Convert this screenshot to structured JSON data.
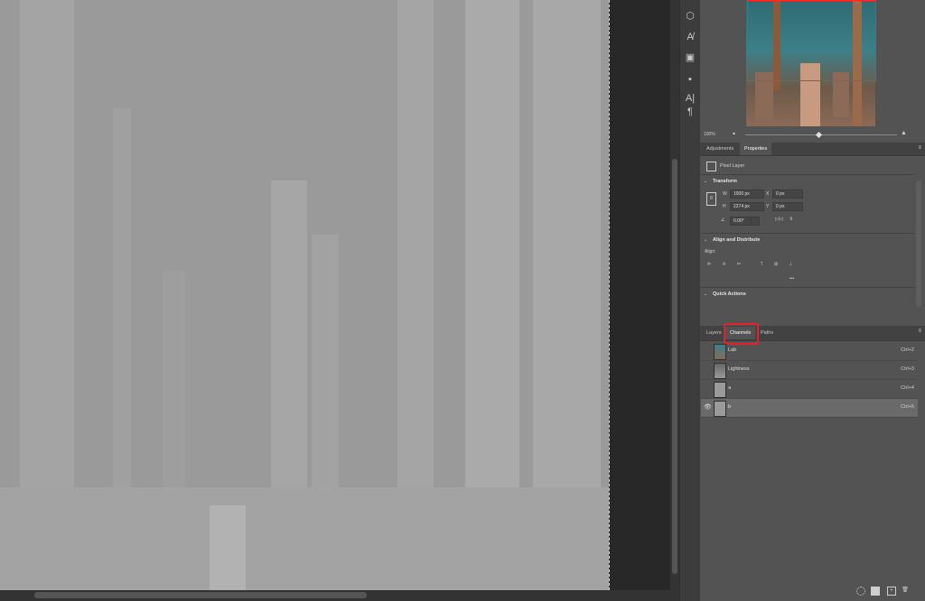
{
  "navigator": {
    "zoom_label": "100%"
  },
  "tool_strip": {
    "icons": [
      "3d-icon",
      "character-style-icon",
      "swatches-icon",
      "libraries-icon",
      "character-icon",
      "paragraph-icon"
    ],
    "glyphs": [
      "⬡",
      "A̸",
      "▣",
      "▪",
      "A|",
      "¶"
    ]
  },
  "properties_panel": {
    "tabs": [
      "Adjustments",
      "Properties"
    ],
    "layer_kind": "Pixel Layer",
    "transform": {
      "title": "Transform",
      "w_label": "W",
      "w_value": "1500 px",
      "h_label": "H",
      "h_value": "2274 px",
      "x_label": "X",
      "x_value": "0 px",
      "y_label": "Y",
      "y_value": "0 px",
      "angle_value": "0.00°"
    },
    "align": {
      "title": "Align and Distribute",
      "align_label": "Align:",
      "more": "•••"
    },
    "quick_actions": {
      "title": "Quick Actions"
    }
  },
  "channels_panel": {
    "tabs": [
      "Layers",
      "Channels",
      "Paths"
    ],
    "rows": [
      {
        "name": "Lab",
        "shortcut": "Ctrl+2"
      },
      {
        "name": "Lightness",
        "shortcut": "Ctrl+3"
      },
      {
        "name": "a",
        "shortcut": "Ctrl+4"
      },
      {
        "name": "b",
        "shortcut": "Ctrl+5"
      }
    ]
  },
  "colors": {
    "highlight": "#e8202a",
    "canvas_gray": "#9a9a9a",
    "panel_bg": "#535353"
  }
}
